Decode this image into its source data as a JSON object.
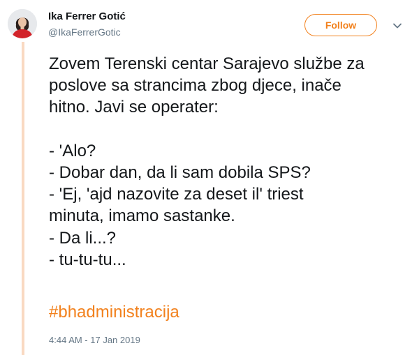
{
  "author": {
    "display_name": "Ika Ferrer Gotić",
    "handle": "@IkaFerrerGotic",
    "avatar_icon": "profile-photo"
  },
  "actions": {
    "follow_label": "Follow",
    "more_icon": "chevron-down-icon"
  },
  "tweet": {
    "lines": [
      "Zovem Terenski centar Sarajevo službe za",
      "poslove sa strancima zbog djece, inače",
      "hitno. Javi se operater:",
      "",
      "- 'Alo?",
      "- Dobar dan, da li sam dobila SPS?",
      "- 'Ej, 'ajd nazovite za deset il' triest",
      "minuta, imamo sastanke.",
      "- Da li...?",
      "- tu-tu-tu..."
    ],
    "hashtag": "#bhadministracija",
    "timestamp": "4:44 AM - 17 Jan 2019"
  },
  "colors": {
    "accent": "#f2811d",
    "text": "#14171a",
    "muted": "#657786",
    "thread_line": "#f9d9c2"
  }
}
